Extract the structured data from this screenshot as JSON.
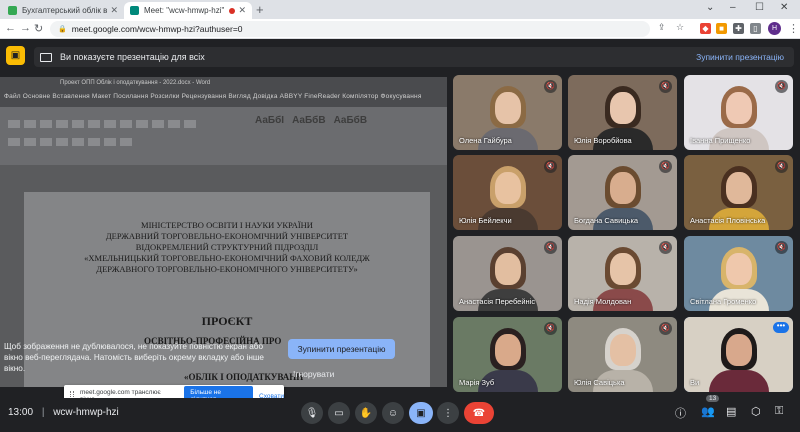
{
  "browser": {
    "tabs": [
      {
        "title": "Бухгалтерський облік в держав...",
        "icon": "sheets-icon",
        "color": "#34a853"
      },
      {
        "title": "Meet: \"wcw-hmwp-hzi\"",
        "icon": "meet-icon",
        "color": "#00897b"
      }
    ],
    "new_tab": "+",
    "url": "meet.google.com/wcw-hmwp-hzi?authuser=0",
    "profile_initial": "H"
  },
  "banner": {
    "message": "Ви показуєте презентацію для всіх",
    "stop_label": "Зупинити презентацію"
  },
  "presentation": {
    "word_title": "Проект ОПП Облік і оподаткування - 2022.docx - Word",
    "word_menus": "Файл  Основне  Вставлення  Макет  Посилання  Розсилки  Рецензування  Вигляд  Довідка  ABBYY FineReader  Компілятор  Фокусування",
    "styles": [
      "АаБбІ",
      "АаБбВ",
      "АаБбВ"
    ],
    "doc_header_lines": [
      "МІНІСТЕРСТВО ОСВІТИ І НАУКИ УКРАЇНИ",
      "ДЕРЖАВНИЙ ТОРГОВЕЛЬНО-ЕКОНОМІЧНИЙ УНІВЕРСИТЕТ",
      "ВІДОКРЕМЛЕНИЙ СТРУКТУРНИЙ ПІДРОЗДІЛ",
      "«ХМЕЛЬНИЦЬКИЙ ТОРГОВЕЛЬНО-ЕКОНОМІЧНИЙ ФАХОВИЙ КОЛЕДЖ",
      "ДЕРЖАВНОГО ТОРГОВЕЛЬНО-ЕКОНОМІЧНОГО УНІВЕРСИТЕТУ»"
    ],
    "doc_project": "ПРОЄКТ",
    "doc_osv": "ОСВІТНЬО-ПРОФЕСІЙНА ПРО",
    "doc_oblik": "«ОБЛІК І ОПОДАТКУВАНН",
    "warning": "Щоб зображення не дублювалося, не показуйте повністю екран або вікно веб-переглядача. Натомість виберіть окрему вкладку або інше вікно.",
    "stop_button": "Зупинити презентацію",
    "ignore": "Ігнорувати",
    "share_text": "meet.google.com транслює вікно.",
    "share_stop": "Більше не ділитися",
    "share_cancel": "Сховати"
  },
  "participants": [
    {
      "name": "Олена Гайбура",
      "bg": "#8a7a6a",
      "hair": "#8b6a44",
      "skin": "#e6c3a8",
      "body": "#6b6a70",
      "muted": true
    },
    {
      "name": "Юлія Воробйова",
      "bg": "#7d6b5c",
      "hair": "#3a2a20",
      "skin": "#e8c6ae",
      "body": "#2a2a2a",
      "muted": true
    },
    {
      "name": "Іванна Прищенко",
      "bg": "#e4e2e6",
      "hair": "#9a6a48",
      "skin": "#efc9b4",
      "body": "#cfc6c2",
      "muted": true
    },
    {
      "name": "Юлія Бейлекчи",
      "bg": "#6b4e3a",
      "hair": "#c9a06a",
      "skin": "#e8c2a0",
      "body": "#4a3a30",
      "muted": true
    },
    {
      "name": "Богдана Савицька",
      "bg": "#a39a92",
      "hair": "#6b4c30",
      "skin": "#d8ad8e",
      "body": "#4c5a6a",
      "muted": true
    },
    {
      "name": "Анастасія Пловінська",
      "bg": "#7a6040",
      "hair": "#4a3020",
      "skin": "#e0b89a",
      "body": "#d4a53a",
      "muted": true
    },
    {
      "name": "Анастасія Перебейніс",
      "bg": "#9a9490",
      "hair": "#5a4030",
      "skin": "#e2bea0",
      "body": "#3e3e3e",
      "muted": true
    },
    {
      "name": "Надія Молдован",
      "bg": "#b8b2aa",
      "hair": "#6a4a32",
      "skin": "#e6c4a8",
      "body": "#8a4a4a",
      "muted": true
    },
    {
      "name": "Світлана Громенко",
      "bg": "#6e8aa0",
      "hair": "#d8b46a",
      "skin": "#efc8ac",
      "body": "#e9e4d8",
      "muted": true
    },
    {
      "name": "Марія Зуб",
      "bg": "#6a7a64",
      "hair": "#2a2020",
      "skin": "#d9a98a",
      "body": "#3a3a4a",
      "muted": true
    },
    {
      "name": "Юлія Савіцька",
      "bg": "#8e8a80",
      "hair": "#d6d2cc",
      "skin": "#e4c0a4",
      "body": "#b8b2a8",
      "muted": true
    },
    {
      "name": "Ви",
      "bg": "#d7d0c4",
      "hair": "#1e1a1a",
      "skin": "#d8a88c",
      "body": "#6a2a3a",
      "muted": false
    }
  ],
  "bottom": {
    "time": "13:00",
    "separator": "|",
    "meeting_code": "wcw-hmwp-hzi",
    "people_count": "13"
  }
}
